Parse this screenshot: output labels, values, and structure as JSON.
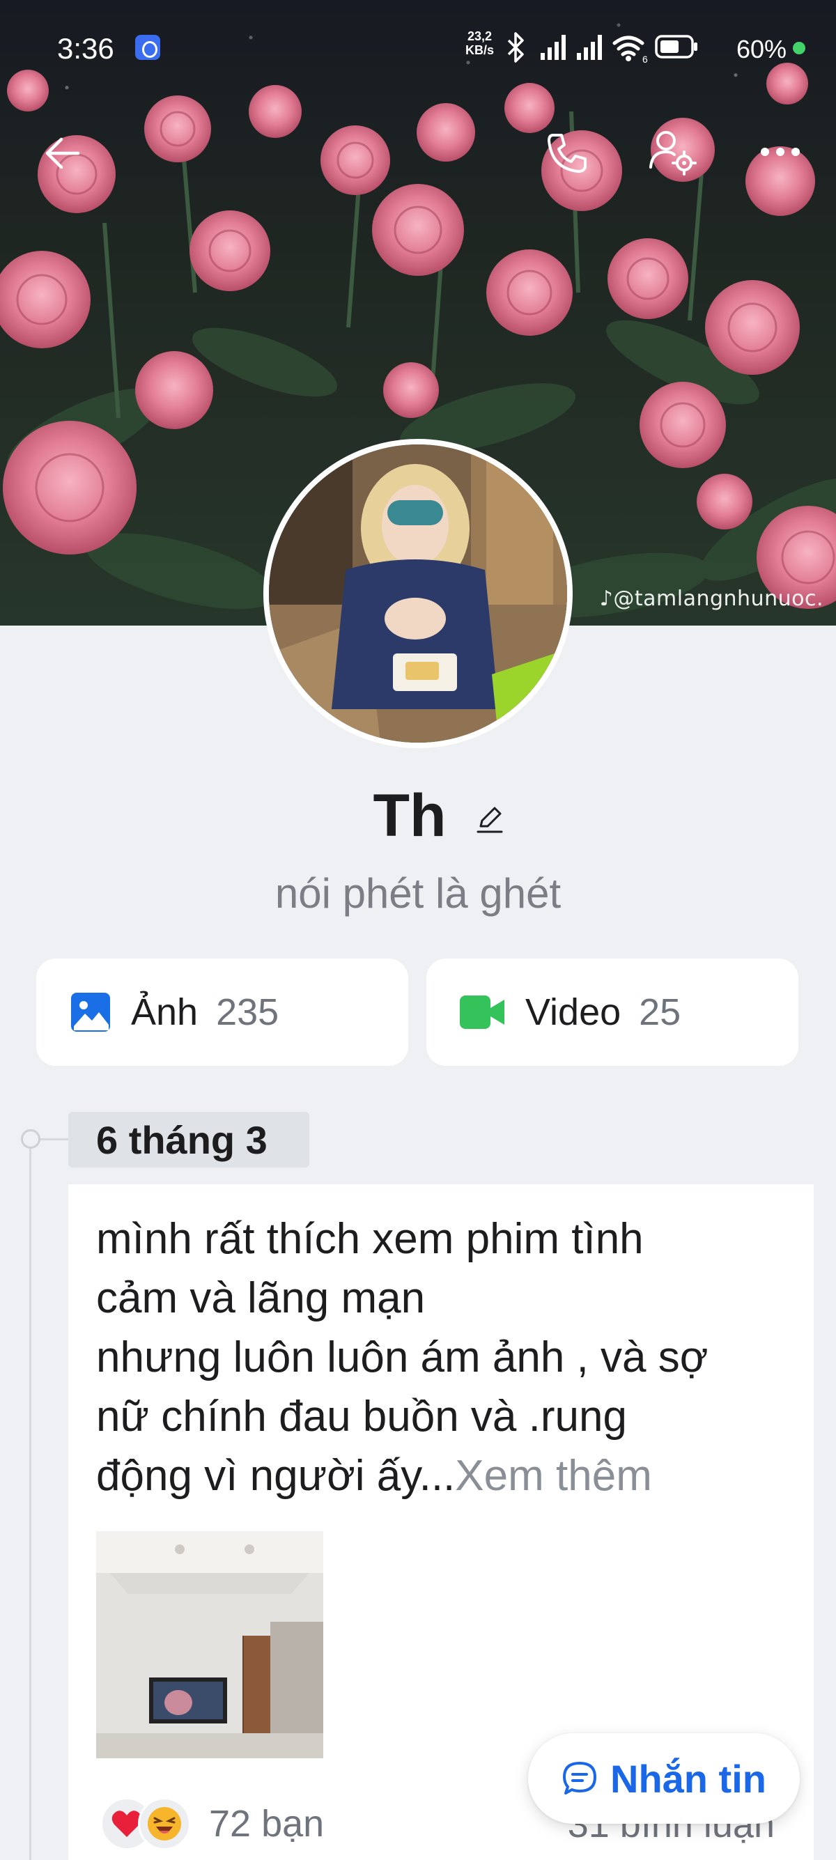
{
  "status_bar": {
    "time": "3:36",
    "net_speed_value": "23,2",
    "net_speed_unit": "KB/s",
    "battery_percent": "60%",
    "signal_badge": "6",
    "icons": [
      "alarm-app-icon",
      "bluetooth-icon",
      "signal-icon",
      "signal-icon",
      "wifi-icon",
      "battery-icon"
    ]
  },
  "nav": {
    "icons": [
      "back-arrow-icon",
      "phone-icon",
      "user-settings-icon",
      "more-icon"
    ]
  },
  "cover": {
    "watermark": "@tamlangnhunuoc."
  },
  "profile": {
    "name": "Th",
    "status": "nói phét là ghét"
  },
  "media": {
    "photos": {
      "label": "Ảnh",
      "count": "235",
      "icon": "image-icon",
      "color": "#1a6fe6"
    },
    "videos": {
      "label": "Video",
      "count": "25",
      "icon": "video-camera-icon",
      "color": "#34c25a"
    }
  },
  "timeline": {
    "date": "6 tháng 3"
  },
  "post": {
    "text": "mình rất thích xem phim tình\ncảm và lãng mạn\nnhưng luôn luôn ám ảnh , và sợ\nnữ chính đau buồn và .rung\nđộng vì người ấy...",
    "see_more": "Xem thêm",
    "reactions": [
      "heart-icon",
      "laughing-face-icon"
    ],
    "reaction_count": "72 bạn",
    "comment_count": "31 bình luận"
  },
  "message_button": {
    "label": "Nhắn tin",
    "icon": "chat-bubble-icon",
    "color": "#1a68e8"
  }
}
